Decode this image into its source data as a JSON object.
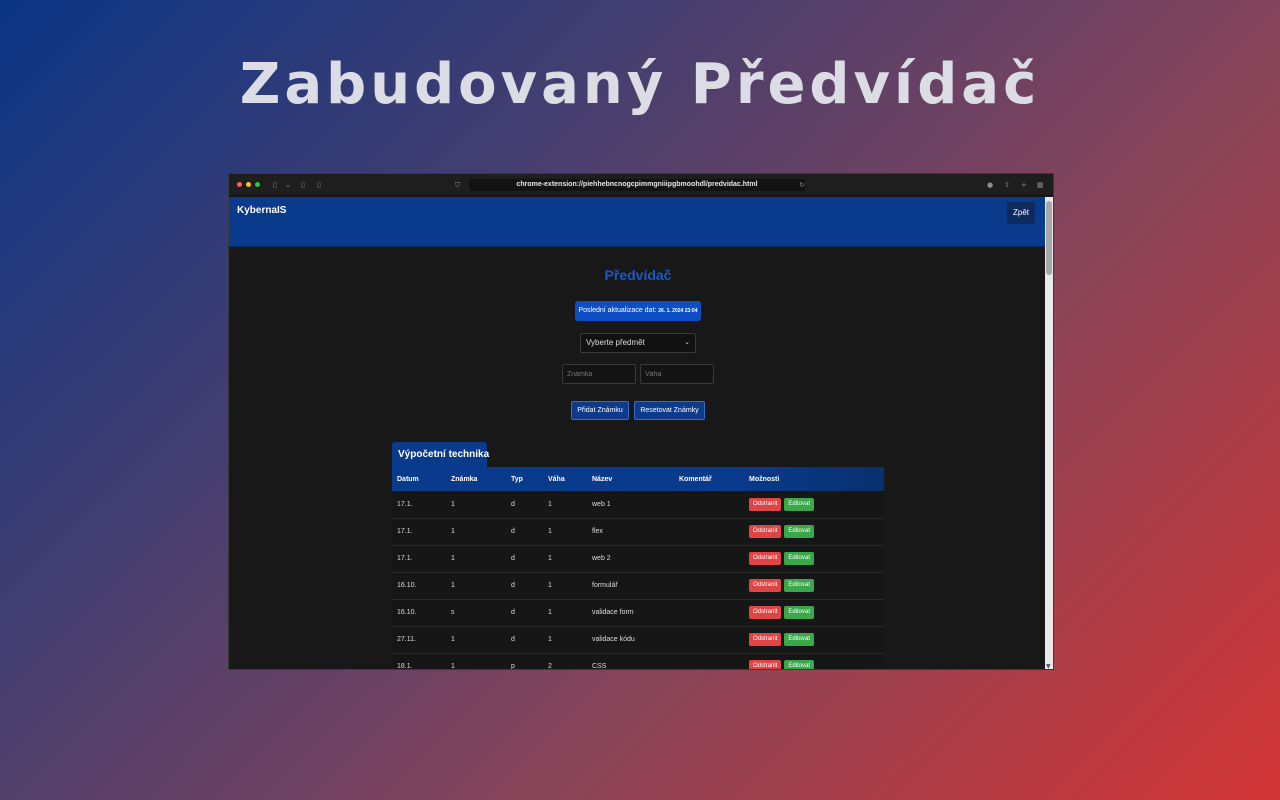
{
  "hero": {
    "title": "Zabudovaný Předvídač"
  },
  "browser": {
    "url": "chrome-extension://piehhebncnogcpimmgniiipgbmoohdl/predvidac.html"
  },
  "nav": {
    "brand": "KybernaIS",
    "back_label": "Zpět"
  },
  "main": {
    "heading": "Předvídač",
    "update_label": "Poslední aktualizace dat:",
    "update_timestamp": "26. 1. 2024 23:04",
    "subject_select": "Vyberte předmět",
    "grade_placeholder": "Známka",
    "weight_placeholder": "Váha",
    "add_button": "Přidat Známku",
    "reset_button": "Resetovat Známky"
  },
  "subject": {
    "title": "Výpočetní technika",
    "columns": [
      "Datum",
      "Známka",
      "Typ",
      "Váha",
      "Název",
      "Komentář",
      "Možnosti"
    ],
    "delete_label": "Odstranit",
    "edit_label": "Editovat",
    "rows": [
      {
        "date": "17.1.",
        "grade": "1",
        "type": "d",
        "weight": "1",
        "name": "web 1",
        "comment": ""
      },
      {
        "date": "17.1.",
        "grade": "1",
        "type": "d",
        "weight": "1",
        "name": "flex",
        "comment": ""
      },
      {
        "date": "17.1.",
        "grade": "1",
        "type": "d",
        "weight": "1",
        "name": "web 2",
        "comment": ""
      },
      {
        "date": "16.10.",
        "grade": "1",
        "type": "d",
        "weight": "1",
        "name": "formulář",
        "comment": ""
      },
      {
        "date": "16.10.",
        "grade": "s",
        "type": "d",
        "weight": "1",
        "name": "validace form",
        "comment": ""
      },
      {
        "date": "27.11.",
        "grade": "1",
        "type": "d",
        "weight": "1",
        "name": "validace kódu",
        "comment": ""
      },
      {
        "date": "18.1.",
        "grade": "1",
        "type": "p",
        "weight": "2",
        "name": "CSS",
        "comment": ""
      }
    ]
  },
  "colors": {
    "nav_blue": "#0a3a8c",
    "heading_blue": "#1d58c8",
    "delete_red": "#e04545",
    "edit_green": "#3aa84a"
  },
  "icons": [
    "shield-icon",
    "reload-icon",
    "privacy-icon",
    "share-icon",
    "new-tab-icon",
    "tabs-grid-icon",
    "sidebar-icon",
    "chevron-down-icon"
  ]
}
